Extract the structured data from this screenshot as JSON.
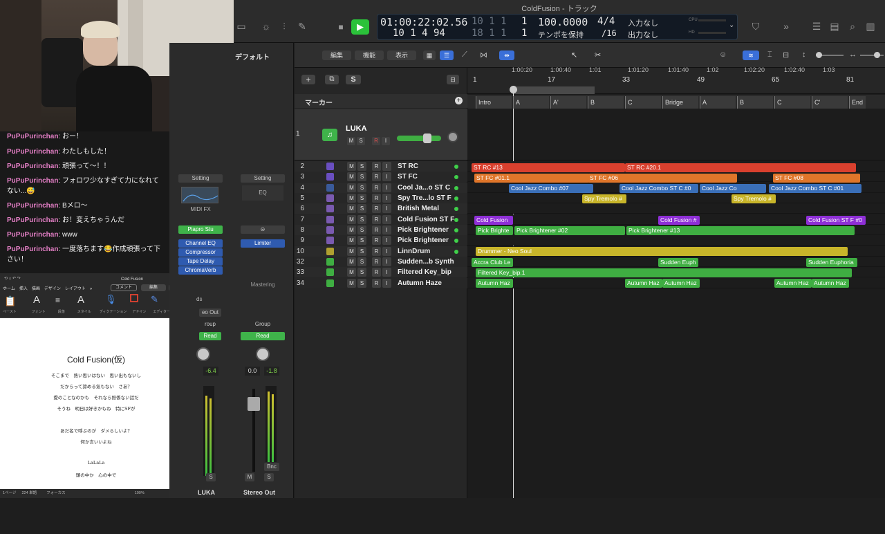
{
  "window": {
    "title": "ColdFusion - トラック"
  },
  "lcd": {
    "time": "01:00:22:02.56",
    "bars": "4 94",
    "bars_small": "10 1 4",
    "beat_top": "10  1  1",
    "beat_top_last": "1",
    "beat_bot": "18  1  1",
    "beat_bot_last": "1",
    "tempo": "100.0000",
    "tempo_mode": "テンポを保持",
    "sig": "4/4",
    "sig_div": "/16",
    "input": "入力なし",
    "output": "出力なし",
    "cpu": "CPU",
    "hd": "HD"
  },
  "chat": {
    "messages": [
      {
        "name": "PuPuPurinchan",
        "text": "おー！"
      },
      {
        "name": "PuPuPurinchan",
        "text": "わたしもした！"
      },
      {
        "name": "PuPuPurinchan",
        "text": "頑張って〜！！"
      },
      {
        "name": "PuPuPurinchan",
        "text": "フォロワ少なすぎて力になれてない...😅"
      },
      {
        "name": "PuPuPurinchan",
        "text": "Bメロ〜"
      },
      {
        "name": "PuPuPurinchan",
        "text": "お！変えちゃうんだ"
      },
      {
        "name": "PuPuPurinchan",
        "text": "www"
      },
      {
        "name": "PuPuPurinchan",
        "text": "一度落ちます😂作成頑張って下さい！"
      }
    ]
  },
  "word": {
    "doc_name": "Cold Fusion",
    "tabs": [
      "ホーム",
      "挿入",
      "描画",
      "デザイン",
      "レイアウト",
      "»"
    ],
    "comment_btn": "コメント",
    "edit_btn": "編集",
    "share_btn": "共有",
    "groups": [
      "ペースト",
      "フォント",
      "段落",
      "スタイル",
      "ディクテーション",
      "アドイン",
      "エディター"
    ],
    "title": "Cold Fusion(仮)",
    "lines": [
      "そこまで　熱い思いはない　思い出もないし",
      "だからって諦める気もない　さあ？",
      "愛のことなのかも　それなら照係ない話だ",
      "そうね　明日は好きかもね　特にSFが",
      "",
      "あだ名で呼ぶのが　ダメらしいよ？",
      "何か言いいよね",
      "",
      "LaLaLa",
      "頭の中か　心の中で"
    ],
    "status": [
      "1ページ",
      "224 単語",
      "フォーカス",
      "100%"
    ]
  },
  "inspector": {
    "region_name": "デフォルト",
    "left_strip": {
      "setting": "Setting",
      "midi_fx": "MIDI FX",
      "instrument": "Piapro Stu",
      "plugins": [
        "Channel EQ",
        "Compressor",
        "Tape Delay",
        "ChromaVerb"
      ],
      "sends": "ds",
      "output": "eo Out",
      "group": "roup",
      "auto": "Read",
      "val1": "-6.4",
      "name": "LUKA",
      "s": "S"
    },
    "right_strip": {
      "setting": "Setting",
      "eq": "EQ",
      "link": "⊝",
      "plugin": "Limiter",
      "mastering": "Mastering",
      "group": "Group",
      "auto": "Read",
      "val1": "0.0",
      "val2": "-1.8",
      "bnc": "Bnc",
      "m": "M",
      "s": "S",
      "name": "Stereo Out"
    }
  },
  "toolbar": {
    "edit": "編集",
    "function": "機能",
    "view": "表示",
    "s_btn": "S"
  },
  "markers_label": "マーカー",
  "ruler_time": [
    "1:00:20",
    "1:00:40",
    "1:01",
    "1:01:20",
    "1:01:40",
    "1:02",
    "1:02:20",
    "1:02:40",
    "1:03"
  ],
  "ruler_bars": [
    "1",
    "17",
    "33",
    "49",
    "65",
    "81"
  ],
  "markers": [
    "Intro",
    "A",
    "A'",
    "B",
    "C",
    "Bridge",
    "A",
    "B",
    "C",
    "C'",
    "End"
  ],
  "tracks": [
    {
      "num": "1",
      "name": "LUKA"
    },
    {
      "num": "2",
      "name": "ST RC"
    },
    {
      "num": "3",
      "name": "ST FC"
    },
    {
      "num": "4",
      "name": "Cool Ja...o ST C"
    },
    {
      "num": "5",
      "name": "Spy Tre...lo ST F"
    },
    {
      "num": "6",
      "name": "British Metal"
    },
    {
      "num": "7",
      "name": "Cold Fusion ST F"
    },
    {
      "num": "8",
      "name": "Pick Brightener"
    },
    {
      "num": "9",
      "name": "Pick Brightener"
    },
    {
      "num": "10",
      "name": "LinnDrum"
    },
    {
      "num": "32",
      "name": "Sudden...b Synth"
    },
    {
      "num": "33",
      "name": "Filtered Key_bip"
    },
    {
      "num": "34",
      "name": "Autumn Haze"
    }
  ],
  "track_buttons": {
    "m": "M",
    "s": "S",
    "r": "R",
    "i": "I"
  },
  "regions": {
    "r2a": "ST RC #13",
    "r2b": "ST RC #20.1",
    "r3a": "ST FC #01.1",
    "r3b": "ST FC #06",
    "r3c": "ST FC #08",
    "r4a": "Cool Jazz Combo #07",
    "r4b": "Cool Jazz Combo ST C #0",
    "r4c": "Cool Jazz Co",
    "r4d": "Cool Jazz Combo ST C #01",
    "r5a": "Spy Tremolo #",
    "r5b": "Spy Tremolo #",
    "r7a": "Cold Fusion",
    "r7b": "Cold Fusion #",
    "r7c": "Cold Fusion ST F #0",
    "r8a": "Pick Brighte",
    "r8b": "Pick Brightener #02",
    "r8c": "Pick Brightener #13",
    "r10": "Drummer - Neo Soul",
    "r32a": "Accra Club Le",
    "r32b": "Sudden Euph",
    "r32c": "Sudden Euphoria",
    "r33": "Filtered Key_bip.1",
    "r34a": "Autumn Haz",
    "r34b": "Autumn Haz",
    "r34c": "Autumn Haz",
    "r34d": "Autumn Haz",
    "r34e": "Autumn Haz"
  },
  "colors": {
    "play": "#2bc23a",
    "red": "#d9402e",
    "orange": "#e0762a",
    "blue": "#3a6fb8",
    "yellow": "#c8b52a",
    "purple": "#8e2fd6",
    "green": "#3fae42"
  }
}
